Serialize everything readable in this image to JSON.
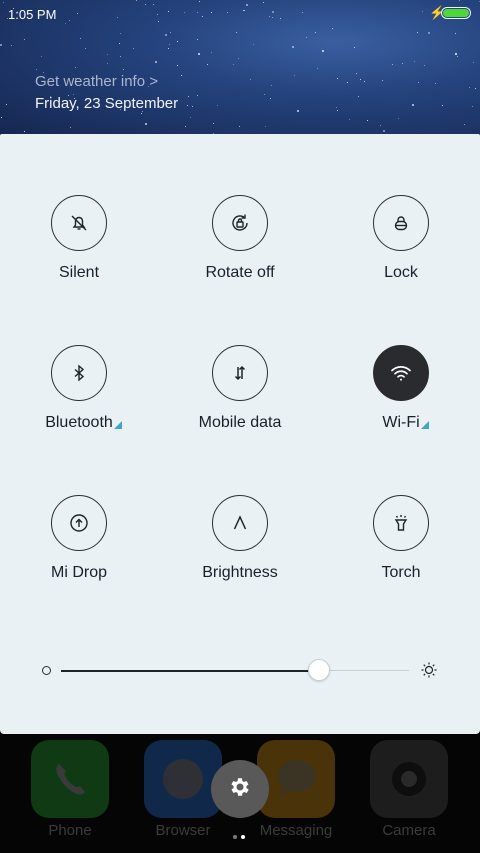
{
  "status_bar": {
    "time": "1:05 PM",
    "charging_icon": "bolt-icon",
    "battery_level": 1.0,
    "battery_color": "#4fd63a"
  },
  "header": {
    "weather_link": "Get weather info >",
    "date": "Friday, 23 September"
  },
  "toggles": [
    {
      "id": "silent",
      "label": "Silent",
      "icon": "bell-off-icon",
      "active": false,
      "expandable": false
    },
    {
      "id": "rotate",
      "label": "Rotate off",
      "icon": "rotate-lock-icon",
      "active": false,
      "expandable": false
    },
    {
      "id": "lock",
      "label": "Lock",
      "icon": "lock-icon",
      "active": false,
      "expandable": false
    },
    {
      "id": "bluetooth",
      "label": "Bluetooth",
      "icon": "bluetooth-icon",
      "active": false,
      "expandable": true
    },
    {
      "id": "mobile-data",
      "label": "Mobile data",
      "icon": "data-arrows-icon",
      "active": false,
      "expandable": false
    },
    {
      "id": "wifi",
      "label": "Wi-Fi",
      "icon": "wifi-icon",
      "active": true,
      "expandable": true
    },
    {
      "id": "mi-drop",
      "label": "Mi Drop",
      "icon": "upload-icon",
      "active": false,
      "expandable": false
    },
    {
      "id": "brightness",
      "label": "Brightness",
      "icon": "auto-brightness-icon",
      "active": false,
      "expandable": false
    },
    {
      "id": "torch",
      "label": "Torch",
      "icon": "flashlight-icon",
      "active": false,
      "expandable": false
    }
  ],
  "brightness_slider": {
    "level": 0.74,
    "min_icon": "dim-circle-icon",
    "max_icon": "sun-icon"
  },
  "dock": [
    {
      "label": "Phone",
      "icon": "phone-icon",
      "color": "#0f3a14"
    },
    {
      "label": "Browser",
      "icon": "browser-icon",
      "color": "#10294a"
    },
    {
      "label": "Messaging",
      "icon": "chat-icon",
      "color": "#4a3308"
    },
    {
      "label": "Camera",
      "icon": "camera-icon",
      "color": "#1d1d1d"
    }
  ],
  "settings_button": {
    "icon": "gear-icon"
  },
  "page_indicator": {
    "pages": 2,
    "current": 2
  },
  "colors": {
    "panel_background": "#eaf1f5",
    "active_tile": "#2a2b2e",
    "expand_indicator": "#3ea6c7",
    "text": "#1a1f2a"
  }
}
